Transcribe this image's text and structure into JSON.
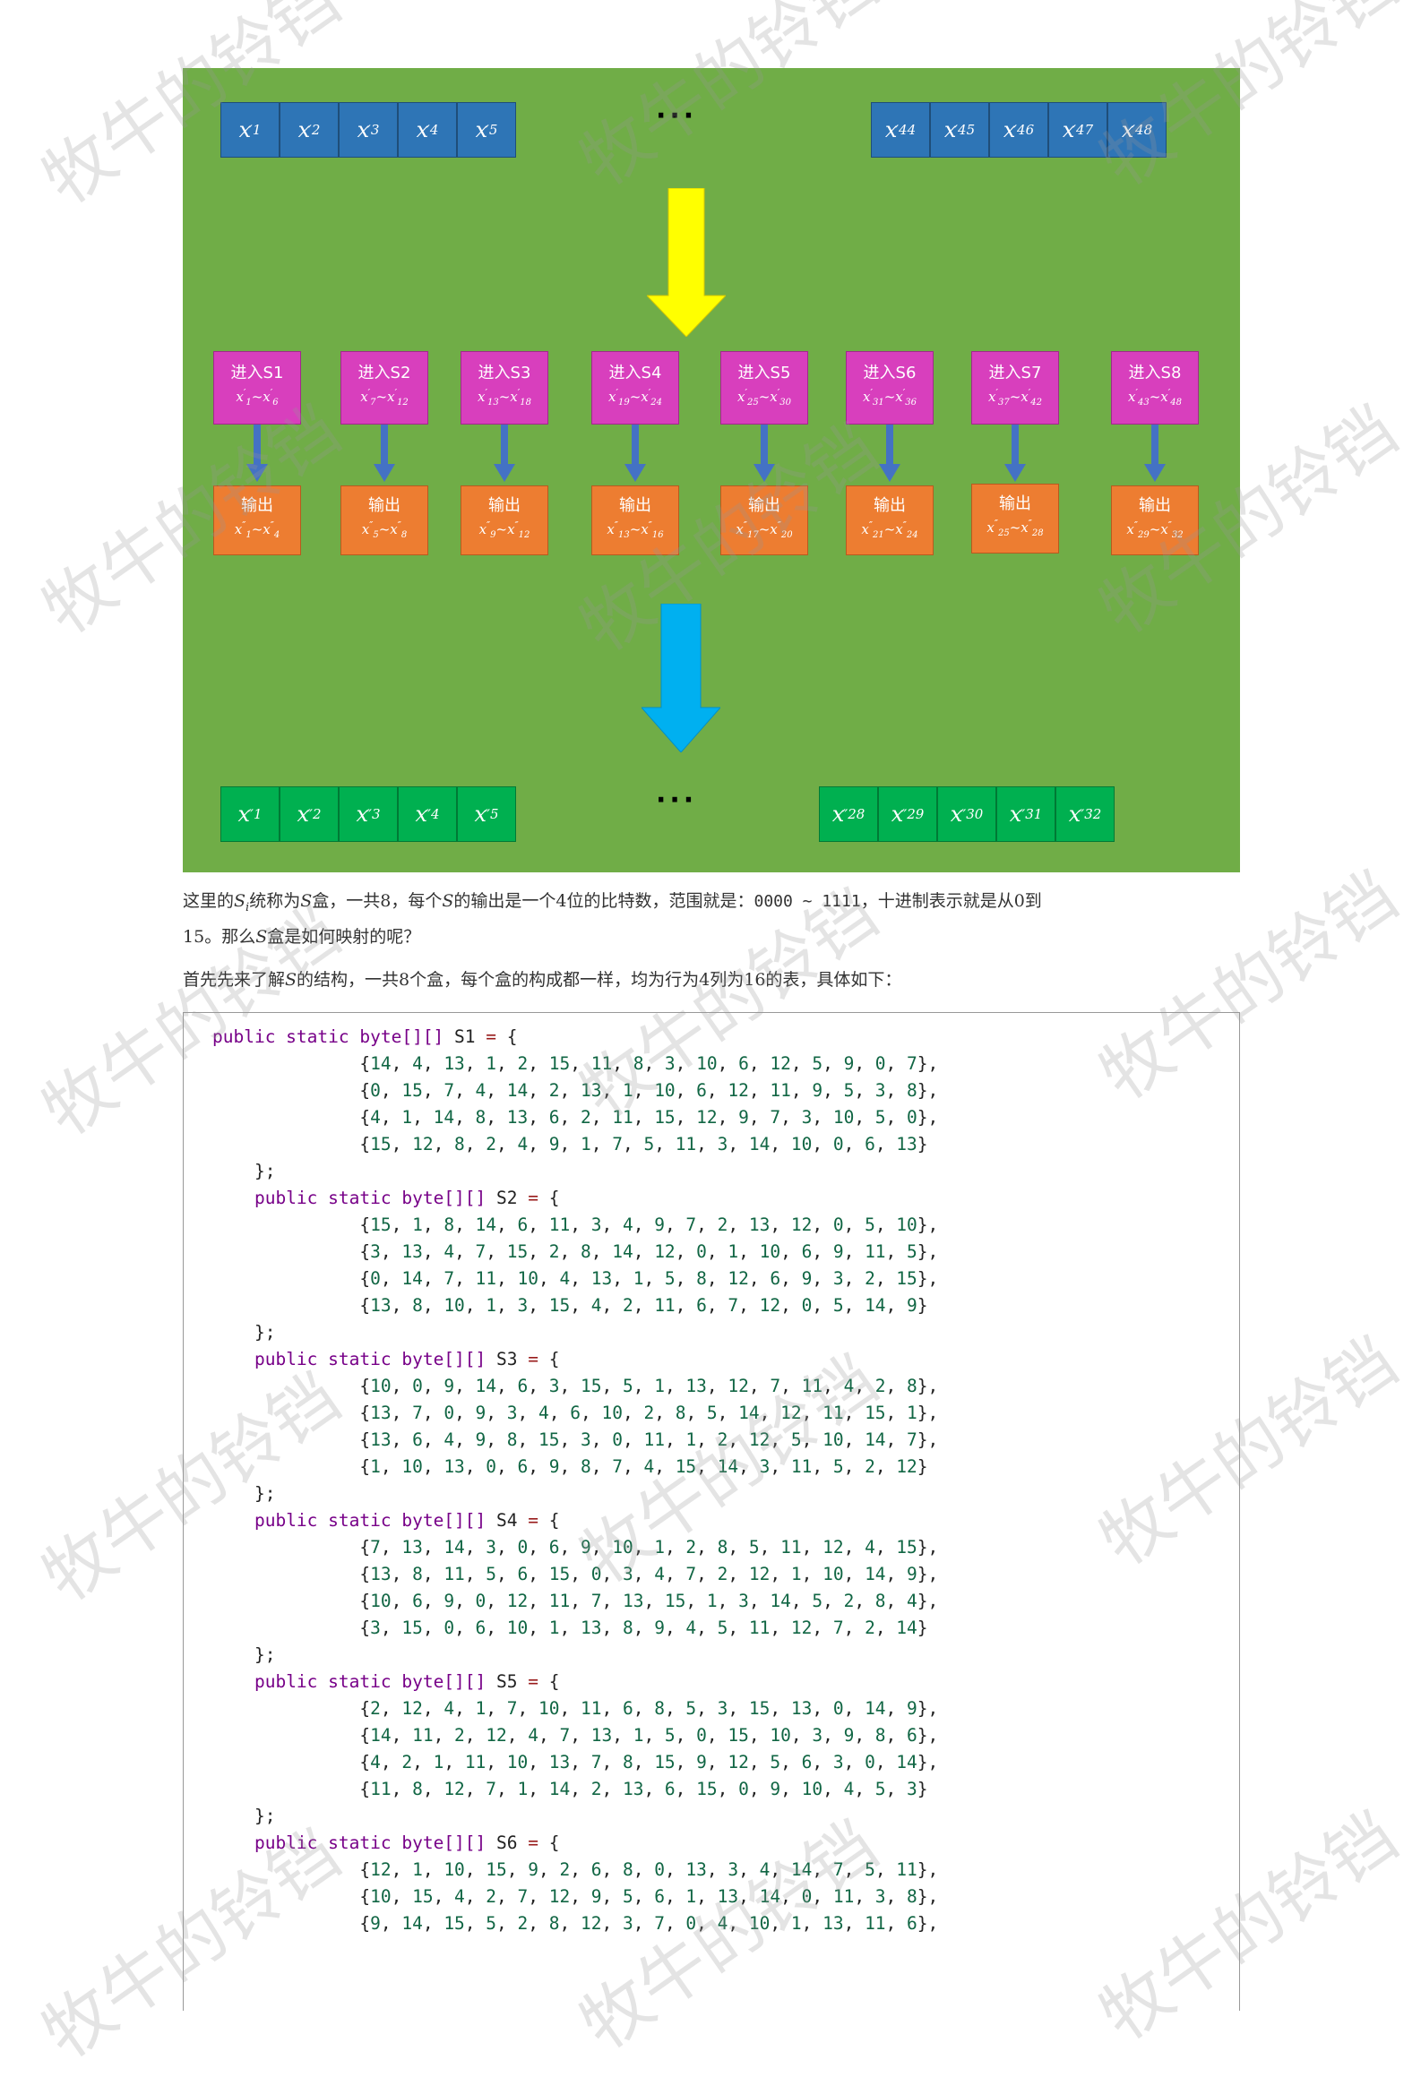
{
  "diagram": {
    "input_left": [
      {
        "base": "x",
        "sub": "1",
        "prime": "′"
      },
      {
        "base": "x",
        "sub": "2",
        "prime": "′"
      },
      {
        "base": "x",
        "sub": "3",
        "prime": "′"
      },
      {
        "base": "x",
        "sub": "4",
        "prime": "′"
      },
      {
        "base": "x",
        "sub": "5",
        "prime": "′"
      }
    ],
    "input_right": [
      {
        "base": "x",
        "sub": "44",
        "prime": "′"
      },
      {
        "base": "x",
        "sub": "45",
        "prime": "′"
      },
      {
        "base": "x",
        "sub": "46",
        "prime": "′"
      },
      {
        "base": "x",
        "sub": "47",
        "prime": "′"
      },
      {
        "base": "x",
        "sub": "48",
        "prime": "′"
      }
    ],
    "ellipsis": "···",
    "colors": {
      "background": "#70ad47",
      "input": "#2e75b6",
      "sbox": "#d83fbd",
      "output_box": "#ed7d31",
      "output": "#00b050",
      "yellow_arrow": "#ffff00",
      "cyan_arrow": "#00b0f0",
      "small_arrow": "#4472c4"
    },
    "sboxes": [
      {
        "title": "进入S1",
        "a": "1",
        "b": "6"
      },
      {
        "title": "进入S2",
        "a": "7",
        "b": "12"
      },
      {
        "title": "进入S3",
        "a": "13",
        "b": "18"
      },
      {
        "title": "进入S4",
        "a": "19",
        "b": "24"
      },
      {
        "title": "进入S5",
        "a": "25",
        "b": "30"
      },
      {
        "title": "进入S6",
        "a": "31",
        "b": "36"
      },
      {
        "title": "进入S7",
        "a": "37",
        "b": "42"
      },
      {
        "title": "进入S8",
        "a": "43",
        "b": "48"
      }
    ],
    "outputs": [
      {
        "title": "输出",
        "a": "1",
        "b": "4"
      },
      {
        "title": "输出",
        "a": "5",
        "b": "8"
      },
      {
        "title": "输出",
        "a": "9",
        "b": "12"
      },
      {
        "title": "输出",
        "a": "13",
        "b": "16"
      },
      {
        "title": "输出",
        "a": "17",
        "b": "20"
      },
      {
        "title": "输出",
        "a": "21",
        "b": "24"
      },
      {
        "title": "输出",
        "a": "25",
        "b": "28"
      },
      {
        "title": "输出",
        "a": "29",
        "b": "32"
      }
    ],
    "output_left": [
      {
        "base": "x",
        "sub": "1",
        "prime": "″"
      },
      {
        "base": "x",
        "sub": "2",
        "prime": "″"
      },
      {
        "base": "x",
        "sub": "3",
        "prime": "″"
      },
      {
        "base": "x",
        "sub": "4",
        "prime": "″"
      },
      {
        "base": "x",
        "sub": "5",
        "prime": "″"
      }
    ],
    "output_right": [
      {
        "base": "x",
        "sub": "28",
        "prime": "″"
      },
      {
        "base": "x",
        "sub": "29",
        "prime": "″"
      },
      {
        "base": "x",
        "sub": "30",
        "prime": "″"
      },
      {
        "base": "x",
        "sub": "31",
        "prime": "″"
      },
      {
        "base": "x",
        "sub": "32",
        "prime": "″"
      }
    ]
  },
  "para1": {
    "t1": "这里的",
    "s_i": "S",
    "s_i_sub": "i",
    "t2": "统称为",
    "s_box": "S",
    "t3": "盒，一共8，每个",
    "s3": "S",
    "t4": "的输出是一个4位的比特数，范围就是：",
    "range": "0000 ~ 1111",
    "t5": "，十进制表示就是从0到",
    "line2a": "15",
    "t6": "。那么",
    "s4": "S",
    "t7": "盒是如何映射的呢？"
  },
  "para2": {
    "t1": "首先先来了解",
    "s": "S",
    "t2": "的结构，一共8个盒，每个盒的构成都一样，均为行为4列为16的表，具体如下："
  },
  "code": {
    "keywords": "public static",
    "type": "byte[][]",
    "boxes": [
      {
        "name": "S1",
        "rows": [
          [
            14,
            4,
            13,
            1,
            2,
            15,
            11,
            8,
            3,
            10,
            6,
            12,
            5,
            9,
            0,
            7
          ],
          [
            0,
            15,
            7,
            4,
            14,
            2,
            13,
            1,
            10,
            6,
            12,
            11,
            9,
            5,
            3,
            8
          ],
          [
            4,
            1,
            14,
            8,
            13,
            6,
            2,
            11,
            15,
            12,
            9,
            7,
            3,
            10,
            5,
            0
          ],
          [
            15,
            12,
            8,
            2,
            4,
            9,
            1,
            7,
            5,
            11,
            3,
            14,
            10,
            0,
            6,
            13
          ]
        ]
      },
      {
        "name": "S2",
        "rows": [
          [
            15,
            1,
            8,
            14,
            6,
            11,
            3,
            4,
            9,
            7,
            2,
            13,
            12,
            0,
            5,
            10
          ],
          [
            3,
            13,
            4,
            7,
            15,
            2,
            8,
            14,
            12,
            0,
            1,
            10,
            6,
            9,
            11,
            5
          ],
          [
            0,
            14,
            7,
            11,
            10,
            4,
            13,
            1,
            5,
            8,
            12,
            6,
            9,
            3,
            2,
            15
          ],
          [
            13,
            8,
            10,
            1,
            3,
            15,
            4,
            2,
            11,
            6,
            7,
            12,
            0,
            5,
            14,
            9
          ]
        ]
      },
      {
        "name": "S3",
        "rows": [
          [
            10,
            0,
            9,
            14,
            6,
            3,
            15,
            5,
            1,
            13,
            12,
            7,
            11,
            4,
            2,
            8
          ],
          [
            13,
            7,
            0,
            9,
            3,
            4,
            6,
            10,
            2,
            8,
            5,
            14,
            12,
            11,
            15,
            1
          ],
          [
            13,
            6,
            4,
            9,
            8,
            15,
            3,
            0,
            11,
            1,
            2,
            12,
            5,
            10,
            14,
            7
          ],
          [
            1,
            10,
            13,
            0,
            6,
            9,
            8,
            7,
            4,
            15,
            14,
            3,
            11,
            5,
            2,
            12
          ]
        ]
      },
      {
        "name": "S4",
        "rows": [
          [
            7,
            13,
            14,
            3,
            0,
            6,
            9,
            10,
            1,
            2,
            8,
            5,
            11,
            12,
            4,
            15
          ],
          [
            13,
            8,
            11,
            5,
            6,
            15,
            0,
            3,
            4,
            7,
            2,
            12,
            1,
            10,
            14,
            9
          ],
          [
            10,
            6,
            9,
            0,
            12,
            11,
            7,
            13,
            15,
            1,
            3,
            14,
            5,
            2,
            8,
            4
          ],
          [
            3,
            15,
            0,
            6,
            10,
            1,
            13,
            8,
            9,
            4,
            5,
            11,
            12,
            7,
            2,
            14
          ]
        ]
      },
      {
        "name": "S5",
        "rows": [
          [
            2,
            12,
            4,
            1,
            7,
            10,
            11,
            6,
            8,
            5,
            3,
            15,
            13,
            0,
            14,
            9
          ],
          [
            14,
            11,
            2,
            12,
            4,
            7,
            13,
            1,
            5,
            0,
            15,
            10,
            3,
            9,
            8,
            6
          ],
          [
            4,
            2,
            1,
            11,
            10,
            13,
            7,
            8,
            15,
            9,
            12,
            5,
            6,
            3,
            0,
            14
          ],
          [
            11,
            8,
            12,
            7,
            1,
            14,
            2,
            13,
            6,
            15,
            0,
            9,
            10,
            4,
            5,
            3
          ]
        ]
      },
      {
        "name": "S6",
        "rows": [
          [
            12,
            1,
            10,
            15,
            9,
            2,
            6,
            8,
            0,
            13,
            3,
            4,
            14,
            7,
            5,
            11
          ],
          [
            10,
            15,
            4,
            2,
            7,
            12,
            9,
            5,
            6,
            1,
            13,
            14,
            0,
            11,
            3,
            8
          ],
          [
            9,
            14,
            15,
            5,
            2,
            8,
            12,
            3,
            7,
            0,
            4,
            10,
            1,
            13,
            11,
            6
          ]
        ]
      }
    ]
  },
  "watermark": "牧牛的铃铛"
}
